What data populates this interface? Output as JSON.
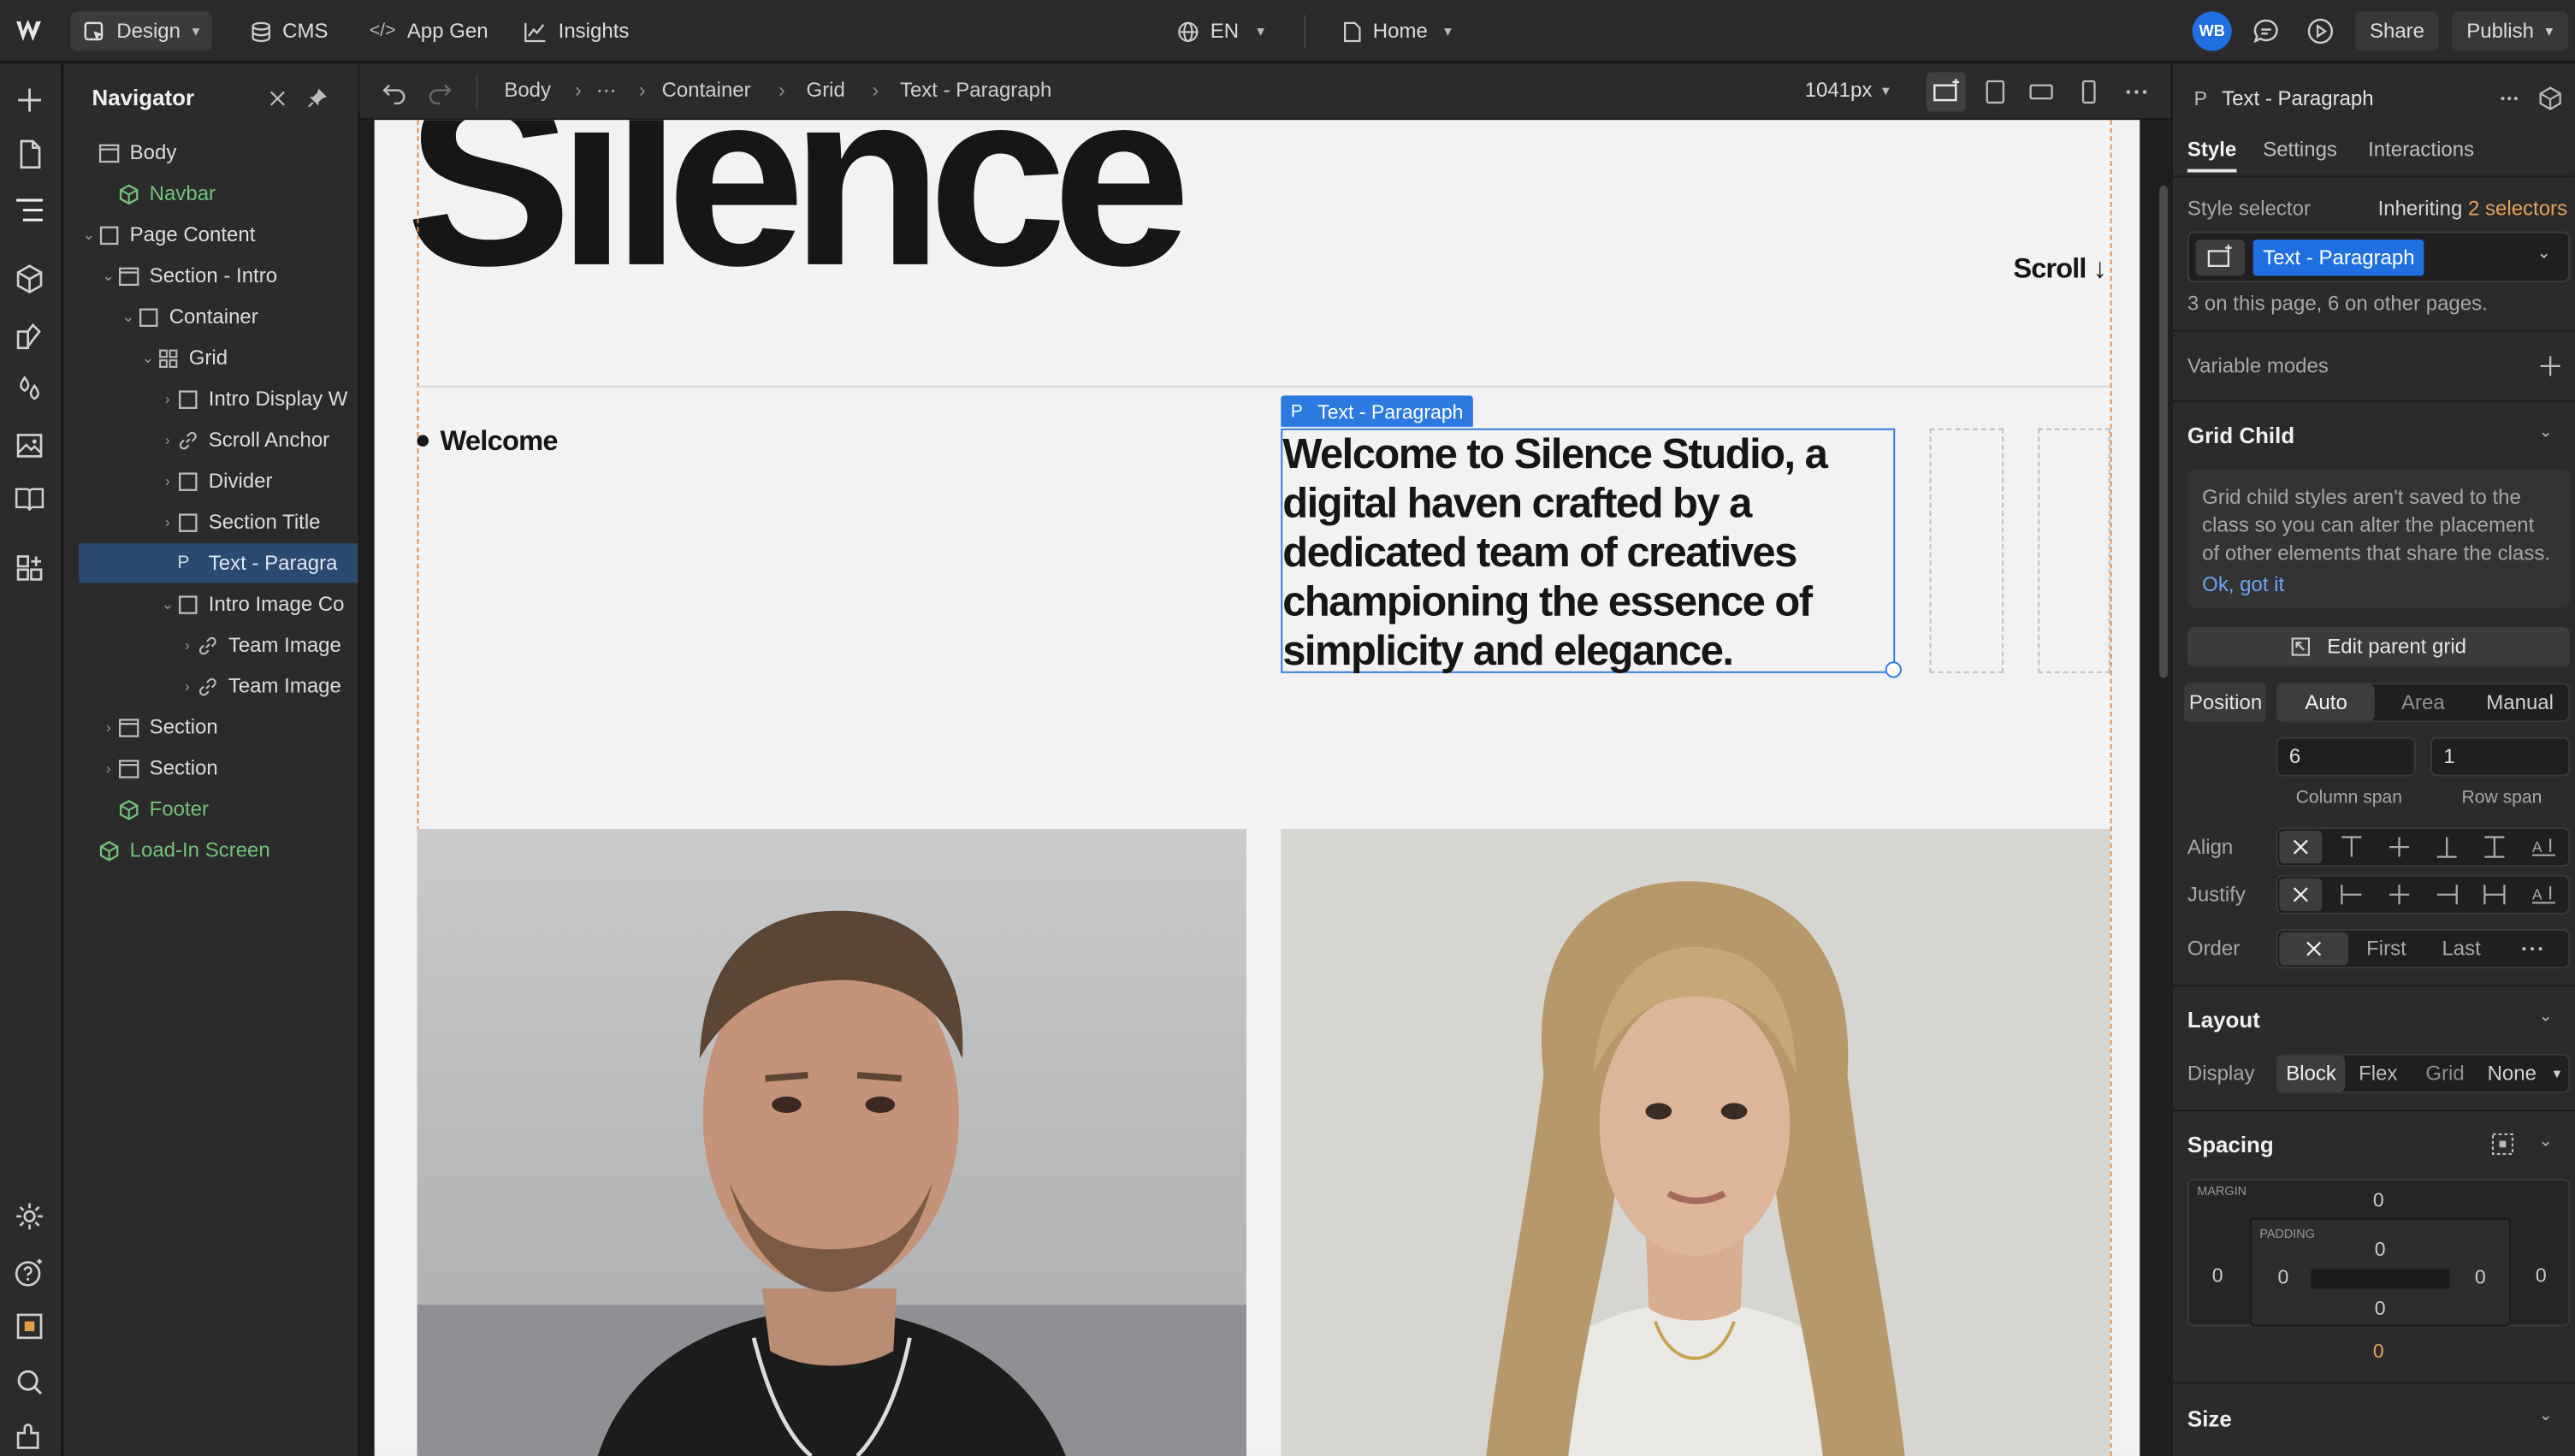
{
  "topbar": {
    "design_label": "Design",
    "cms_label": "CMS",
    "appgen_label": "App Gen",
    "insights_label": "Insights",
    "locale_label": "EN",
    "page_label": "Home",
    "avatar_initials": "WB",
    "share_label": "Share",
    "publish_label": "Publish"
  },
  "navigator": {
    "title": "Navigator",
    "items": [
      {
        "label": "Body"
      },
      {
        "label": "Navbar"
      },
      {
        "label": "Page Content"
      },
      {
        "label": "Section - Intro"
      },
      {
        "label": "Container"
      },
      {
        "label": "Grid"
      },
      {
        "label": "Intro Display W"
      },
      {
        "label": "Scroll Anchor"
      },
      {
        "label": "Divider"
      },
      {
        "label": "Section Title"
      },
      {
        "label": "Text - Paragra"
      },
      {
        "label": "Intro Image Co"
      },
      {
        "label": "Team Image"
      },
      {
        "label": "Team Image"
      },
      {
        "label": "Section"
      },
      {
        "label": "Section"
      },
      {
        "label": "Footer"
      },
      {
        "label": "Load-In Screen"
      }
    ]
  },
  "breadcrumb": {
    "items": [
      "Body",
      "···",
      "Container",
      "Grid",
      "Text - Paragraph"
    ],
    "width_label": "1041px"
  },
  "canvas": {
    "hero_title": "Silence",
    "scroll_label": "Scroll ↓",
    "welcome_label": "Welcome",
    "selection_tag": "Text - Paragraph",
    "selection_tag_icon": "P",
    "paragraph_lines": [
      "Welcome to Silence Studio, a",
      "digital haven crafted by a",
      "dedicated team of creatives",
      "championing the essence of",
      "simplicity and elegance."
    ]
  },
  "panel": {
    "element_icon": "P",
    "element_name": "Text - Paragraph",
    "tabs": [
      "Style",
      "Settings",
      "Interactions"
    ],
    "style_selector_label": "Style selector",
    "inheriting_label": "Inheriting",
    "inheriting_count": "2 selectors",
    "selector_chip": "Text - Paragraph",
    "usage_note": "3 on this page, 6 on other pages.",
    "variable_modes_label": "Variable modes",
    "grid_child": {
      "title": "Grid Child",
      "note_lines": [
        "Grid child styles aren't saved to the",
        "class so you can alter the placement",
        "of other elements that share the class."
      ],
      "ok_label": "Ok, got it",
      "edit_parent_label": "Edit parent grid",
      "position_label": "Position",
      "position_options": [
        "Auto",
        "Area",
        "Manual"
      ],
      "column_span": "6",
      "row_span": "1",
      "column_span_label": "Column span",
      "row_span_label": "Row span",
      "align_label": "Align",
      "justify_label": "Justify",
      "order_label": "Order",
      "order_options": [
        "First",
        "Last"
      ]
    },
    "layout": {
      "title": "Layout",
      "display_label": "Display",
      "display_options": [
        "Block",
        "Flex",
        "Grid",
        "None"
      ]
    },
    "spacing": {
      "title": "Spacing",
      "margin_label": "MARGIN",
      "padding_label": "PADDING",
      "margin_top": "0",
      "margin_left": "0",
      "margin_right": "0",
      "margin_bottom": "0",
      "padding_top": "0",
      "padding_left": "0",
      "padding_right": "0",
      "padding_bottom": "0"
    },
    "size_title": "Size"
  },
  "colors": {
    "accent_blue": "#1f6fe0",
    "selection_blue": "#2c79e0",
    "component_green": "#72c27a",
    "guide_orange": "#e0894a"
  }
}
